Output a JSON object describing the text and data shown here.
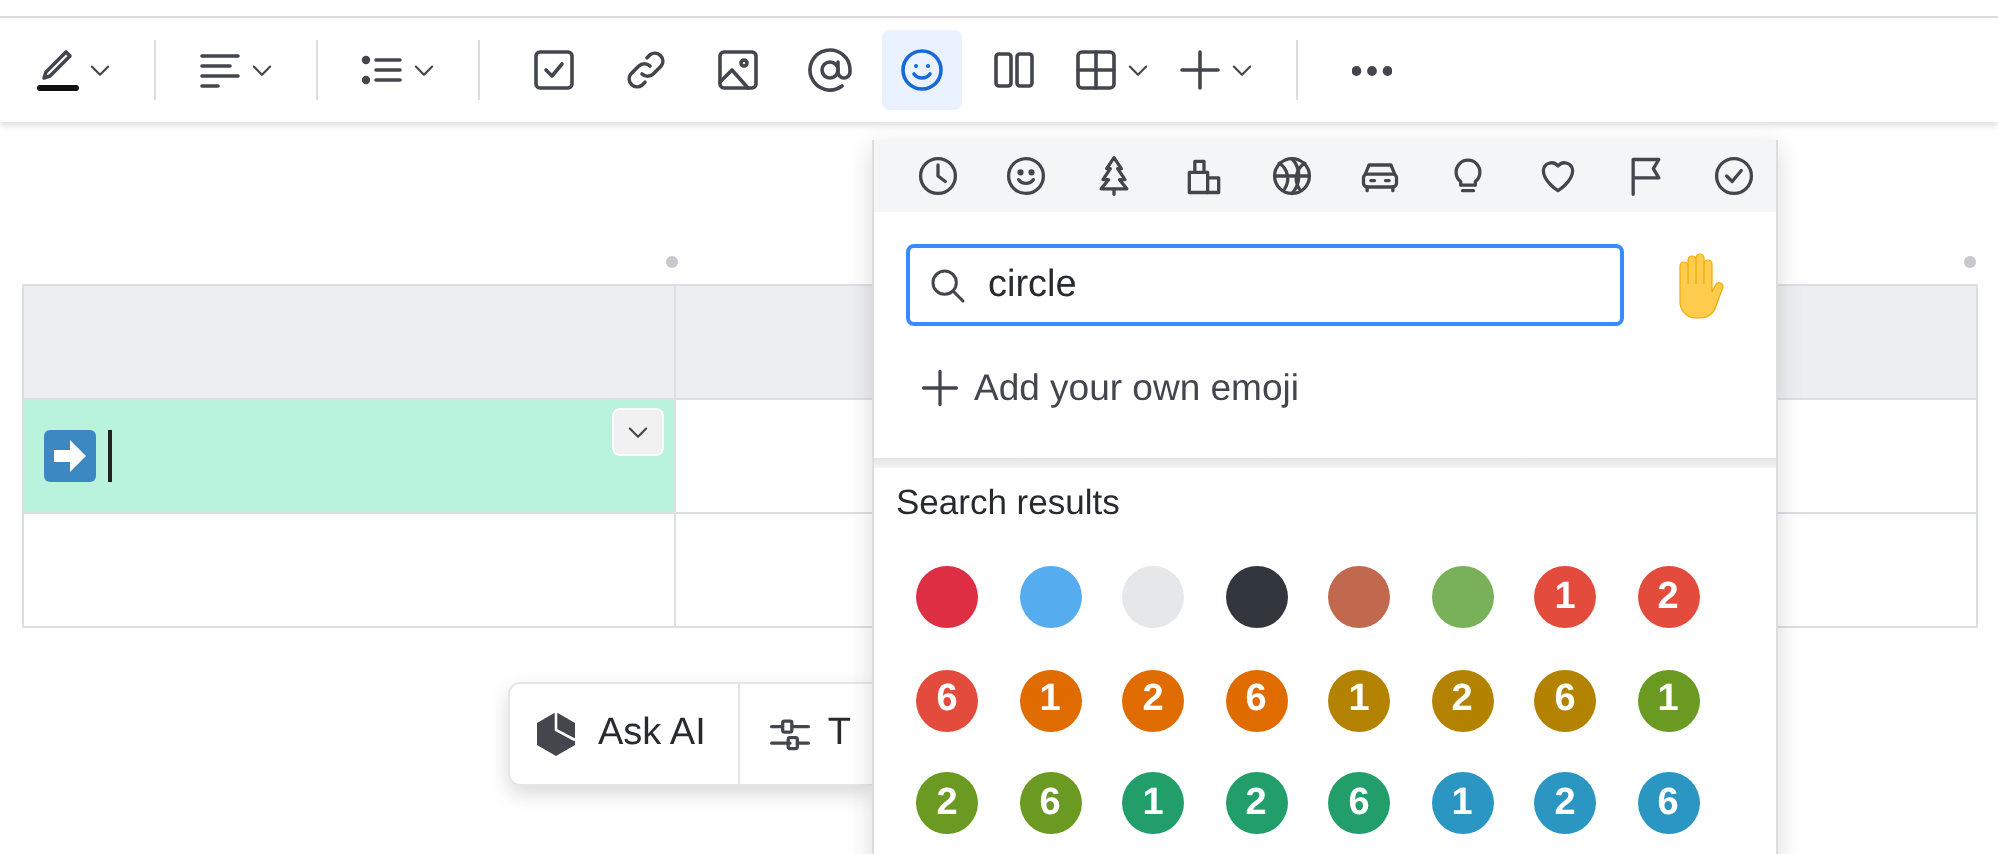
{
  "toolbar": {
    "items": [
      {
        "kind": "button",
        "dropdown": true,
        "selected": false
      },
      {
        "kind": "separator"
      },
      {
        "kind": "button",
        "dropdown": true,
        "selected": false
      },
      {
        "kind": "separator"
      },
      {
        "kind": "button",
        "dropdown": true,
        "selected": false
      },
      {
        "kind": "separator"
      },
      {
        "kind": "button",
        "dropdown": false,
        "selected": false
      },
      {
        "kind": "button",
        "dropdown": false,
        "selected": false
      },
      {
        "kind": "button",
        "dropdown": false,
        "selected": false
      },
      {
        "kind": "button",
        "dropdown": false,
        "selected": false
      },
      {
        "kind": "button",
        "dropdown": false,
        "selected": true
      },
      {
        "kind": "button",
        "dropdown": false,
        "selected": false
      },
      {
        "kind": "button",
        "dropdown": true,
        "selected": false
      },
      {
        "kind": "button",
        "dropdown": true,
        "selected": false
      },
      {
        "kind": "separator"
      },
      {
        "kind": "button",
        "dropdown": false,
        "selected": false
      }
    ]
  },
  "table": {
    "header": {
      "cells": [
        {
          "selected": false,
          "emoji": false
        },
        {
          "selected": false,
          "emoji": false
        }
      ]
    },
    "rows": [
      {
        "cells": [
          {
            "selected": true,
            "emoji": true
          },
          {
            "selected": false,
            "emoji": false
          }
        ]
      },
      {
        "cells": [
          {
            "selected": false,
            "emoji": false
          },
          {
            "selected": false,
            "emoji": false
          }
        ]
      }
    ]
  },
  "ai_bar": {
    "buttons": [
      {
        "label": "Ask AI"
      },
      {
        "label": "T"
      }
    ]
  },
  "emoji_picker": {
    "search": {
      "value": "circle"
    },
    "add_label": "Add your own emoji",
    "results_heading": "Search results",
    "results": [
      {
        "color": "#dd2e44"
      },
      {
        "color": "#55acee"
      },
      {
        "color": "#e6e7e8"
      },
      {
        "color": "#31373d"
      },
      {
        "color": "#c1694f"
      },
      {
        "color": "#78b159"
      },
      {
        "color": "#e34b3d",
        "label": "1"
      },
      {
        "color": "#e34b3d",
        "label": "2"
      },
      {
        "color": "#e34b3d",
        "label": "6"
      },
      {
        "color": "#e06c00",
        "label": "1"
      },
      {
        "color": "#e06c00",
        "label": "2"
      },
      {
        "color": "#e06c00",
        "label": "6"
      },
      {
        "color": "#b38300",
        "label": "1"
      },
      {
        "color": "#b38300",
        "label": "2"
      },
      {
        "color": "#b38300",
        "label": "6"
      },
      {
        "color": "#6a9a22",
        "label": "1"
      },
      {
        "color": "#6a9a22",
        "label": "2"
      },
      {
        "color": "#6a9a22",
        "label": "6"
      },
      {
        "color": "#229e6b",
        "label": "1"
      },
      {
        "color": "#229e6b",
        "label": "2"
      },
      {
        "color": "#229e6b",
        "label": "6"
      },
      {
        "color": "#2a96c1",
        "label": "1"
      },
      {
        "color": "#2a96c1",
        "label": "2"
      },
      {
        "color": "#2a96c1",
        "label": "6"
      }
    ]
  }
}
